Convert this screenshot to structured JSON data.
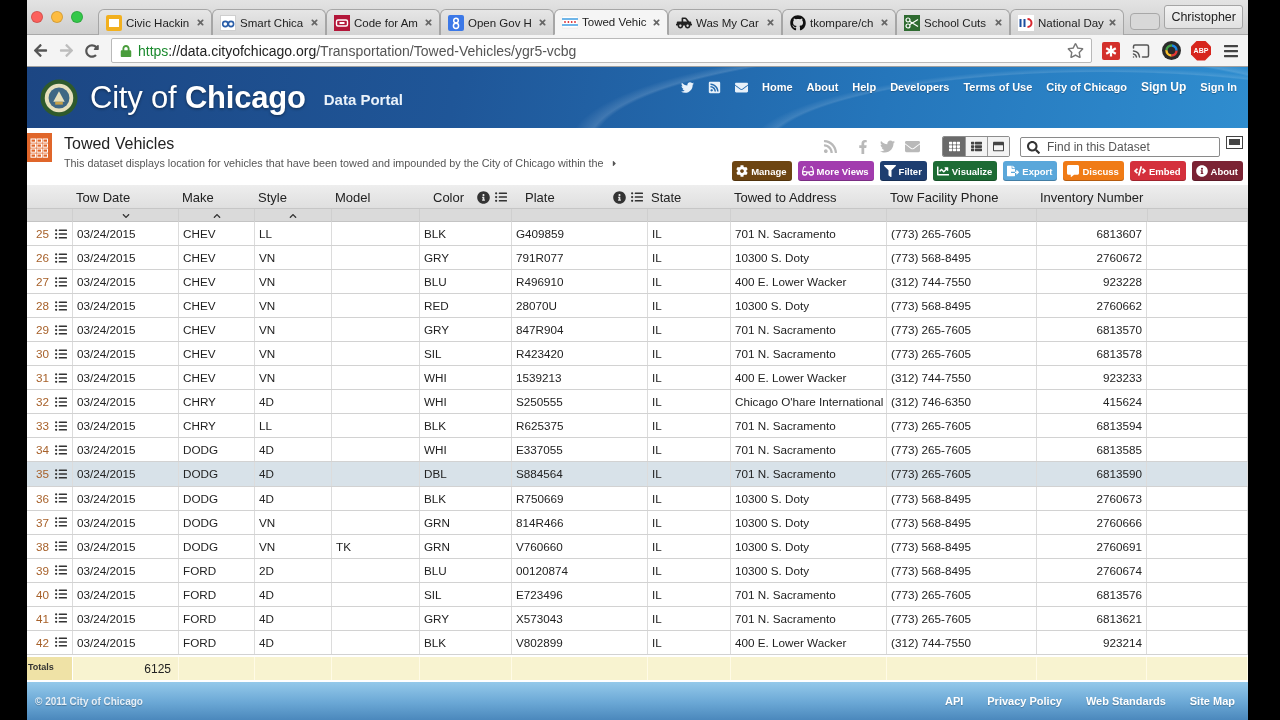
{
  "browser": {
    "tabs": [
      {
        "title": "Civic Hackin",
        "selected": false
      },
      {
        "title": "Smart Chica",
        "selected": false
      },
      {
        "title": "Code for Am",
        "selected": false
      },
      {
        "title": "Open Gov H",
        "selected": false
      },
      {
        "title": "Towed Vehic",
        "selected": true
      },
      {
        "title": "Was My Car",
        "selected": false
      },
      {
        "title": "tkompare/ch",
        "selected": false
      },
      {
        "title": "School Cuts",
        "selected": false
      },
      {
        "title": "National Day",
        "selected": false
      }
    ],
    "profile": "Christopher",
    "back_disabled": false,
    "forward_disabled": true,
    "url_parts": [
      {
        "kind": "scheme",
        "text": "https"
      },
      {
        "kind": "host",
        "text": "://data.cityofchicago.org"
      },
      {
        "kind": "path",
        "text": "/Transportation/Towed-Vehicles/ygr5-vcbg"
      }
    ],
    "extension_label": "ABP"
  },
  "site_header": {
    "title": "City of **Chicago**",
    "subtitle": "Data Portal",
    "links": [
      {
        "label": "Home",
        "prominent": false
      },
      {
        "label": "About",
        "prominent": false
      },
      {
        "label": "Help",
        "prominent": false
      },
      {
        "label": "Developers",
        "prominent": false
      },
      {
        "label": "Terms of Use",
        "prominent": false
      },
      {
        "label": "City of Chicago",
        "prominent": false
      },
      {
        "label": "Sign Up",
        "prominent": true
      },
      {
        "label": "Sign In",
        "prominent": false
      }
    ]
  },
  "dataset": {
    "title": "Towed Vehicles",
    "description": "This dataset displays location for vehicles that have been towed and impounded by the City of Chicago within the",
    "view_modes": [
      {
        "kind": "grid",
        "selected": true
      },
      {
        "kind": "list",
        "selected": false
      },
      {
        "kind": "page",
        "selected": false
      }
    ],
    "search": {
      "placeholder": "Find in this Dataset"
    },
    "actions": [
      {
        "label": "Manage",
        "color": "#6d4512"
      },
      {
        "label": "More Views",
        "color": "#a23cae"
      },
      {
        "label": "Filter",
        "color": "#1e3e70"
      },
      {
        "label": "Visualize",
        "color": "#1d6b34"
      },
      {
        "label": "Export",
        "color": "#5aa7da"
      },
      {
        "label": "Discuss",
        "color": "#f07b16"
      },
      {
        "label": "Embed",
        "color": "#d4303c"
      },
      {
        "label": "About",
        "color": "#7b2334"
      }
    ]
  },
  "table": {
    "columns": [
      {
        "label": "Tow Date",
        "sorted": true,
        "descending": true,
        "tools": false,
        "kind": "text"
      },
      {
        "label": "Make",
        "sorted": true,
        "descending": false,
        "tools": false,
        "kind": "text"
      },
      {
        "label": "Style",
        "sorted": true,
        "descending": false,
        "tools": false,
        "kind": "text"
      },
      {
        "label": "Model",
        "sorted": false,
        "tools": false,
        "kind": "text"
      },
      {
        "label": "Color",
        "sorted": false,
        "tools": true,
        "kind": "text"
      },
      {
        "label": "Plate",
        "sorted": false,
        "tools": true,
        "kind": "text"
      },
      {
        "label": "State",
        "sorted": false,
        "tools": false,
        "kind": "text"
      },
      {
        "label": "Towed to Address",
        "sorted": false,
        "tools": false,
        "kind": "text"
      },
      {
        "label": "Tow Facility Phone",
        "sorted": false,
        "tools": false,
        "kind": "text"
      },
      {
        "label": "Inventory Number",
        "sorted": false,
        "tools": false,
        "kind": "number"
      }
    ],
    "rows": [
      {
        "number": "25",
        "selected": false,
        "cells": [
          "03/24/2015",
          "CHEV",
          "LL",
          null,
          "BLK",
          "G409859",
          "IL",
          "701 N. Sacramento",
          "(773) 265-7605",
          "6813607"
        ]
      },
      {
        "number": "26",
        "selected": false,
        "cells": [
          "03/24/2015",
          "CHEV",
          "VN",
          null,
          "GRY",
          "791R077",
          "IL",
          "10300 S. Doty",
          "(773) 568-8495",
          "2760672"
        ]
      },
      {
        "number": "27",
        "selected": false,
        "cells": [
          "03/24/2015",
          "CHEV",
          "VN",
          null,
          "BLU",
          "R496910",
          "IL",
          "400 E. Lower Wacker",
          "(312) 744-7550",
          "923228"
        ]
      },
      {
        "number": "28",
        "selected": false,
        "cells": [
          "03/24/2015",
          "CHEV",
          "VN",
          null,
          "RED",
          "28070U",
          "IL",
          "10300 S. Doty",
          "(773) 568-8495",
          "2760662"
        ]
      },
      {
        "number": "29",
        "selected": false,
        "cells": [
          "03/24/2015",
          "CHEV",
          "VN",
          null,
          "GRY",
          "847R904",
          "IL",
          "701 N. Sacramento",
          "(773) 265-7605",
          "6813570"
        ]
      },
      {
        "number": "30",
        "selected": false,
        "cells": [
          "03/24/2015",
          "CHEV",
          "VN",
          null,
          "SIL",
          "R423420",
          "IL",
          "701 N. Sacramento",
          "(773) 265-7605",
          "6813578"
        ]
      },
      {
        "number": "31",
        "selected": false,
        "cells": [
          "03/24/2015",
          "CHEV",
          "VN",
          null,
          "WHI",
          "1539213",
          "IL",
          "400 E. Lower Wacker",
          "(312) 744-7550",
          "923233"
        ]
      },
      {
        "number": "32",
        "selected": false,
        "cells": [
          "03/24/2015",
          "CHRY",
          "4D",
          null,
          "WHI",
          "S250555",
          "IL",
          "Chicago O'hare International",
          "(312) 746-6350",
          "415624"
        ]
      },
      {
        "number": "33",
        "selected": false,
        "cells": [
          "03/24/2015",
          "CHRY",
          "LL",
          null,
          "BLK",
          "R625375",
          "IL",
          "701 N. Sacramento",
          "(773) 265-7605",
          "6813594"
        ]
      },
      {
        "number": "34",
        "selected": false,
        "cells": [
          "03/24/2015",
          "DODG",
          "4D",
          null,
          "WHI",
          "E337055",
          "IL",
          "701 N. Sacramento",
          "(773) 265-7605",
          "6813585"
        ]
      },
      {
        "number": "35",
        "selected": true,
        "cells": [
          "03/24/2015",
          "DODG",
          "4D",
          null,
          "DBL",
          "S884564",
          "IL",
          "701 N. Sacramento",
          "(773) 265-7605",
          "6813590"
        ]
      },
      {
        "number": "36",
        "selected": false,
        "cells": [
          "03/24/2015",
          "DODG",
          "4D",
          null,
          "BLK",
          "R750669",
          "IL",
          "10300 S. Doty",
          "(773) 568-8495",
          "2760673"
        ]
      },
      {
        "number": "37",
        "selected": false,
        "cells": [
          "03/24/2015",
          "DODG",
          "VN",
          null,
          "GRN",
          "814R466",
          "IL",
          "10300 S. Doty",
          "(773) 568-8495",
          "2760666"
        ]
      },
      {
        "number": "38",
        "selected": false,
        "cells": [
          "03/24/2015",
          "DODG",
          "VN",
          "TK",
          "GRN",
          "V760660",
          "IL",
          "10300 S. Doty",
          "(773) 568-8495",
          "2760691"
        ]
      },
      {
        "number": "39",
        "selected": false,
        "cells": [
          "03/24/2015",
          "FORD",
          "2D",
          null,
          "BLU",
          "00120874",
          "IL",
          "10300 S. Doty",
          "(773) 568-8495",
          "2760674"
        ]
      },
      {
        "number": "40",
        "selected": false,
        "cells": [
          "03/24/2015",
          "FORD",
          "4D",
          null,
          "SIL",
          "E723496",
          "IL",
          "701 N. Sacramento",
          "(773) 265-7605",
          "6813576"
        ]
      },
      {
        "number": "41",
        "selected": false,
        "cells": [
          "03/24/2015",
          "FORD",
          "4D",
          null,
          "GRY",
          "X573043",
          "IL",
          "701 N. Sacramento",
          "(773) 265-7605",
          "6813621"
        ]
      },
      {
        "number": "42",
        "selected": false,
        "cells": [
          "03/24/2015",
          "FORD",
          "4D",
          null,
          "BLK",
          "V802899",
          "IL",
          "400 E. Lower Wacker",
          "(312) 744-7550",
          "923214"
        ]
      }
    ],
    "totals": {
      "label": "Totals",
      "value": "6125"
    }
  },
  "footer": {
    "copyright": "© 2011 City of Chicago",
    "links": [
      "API",
      "Privacy Policy",
      "Web Standards",
      "Site Map"
    ]
  }
}
